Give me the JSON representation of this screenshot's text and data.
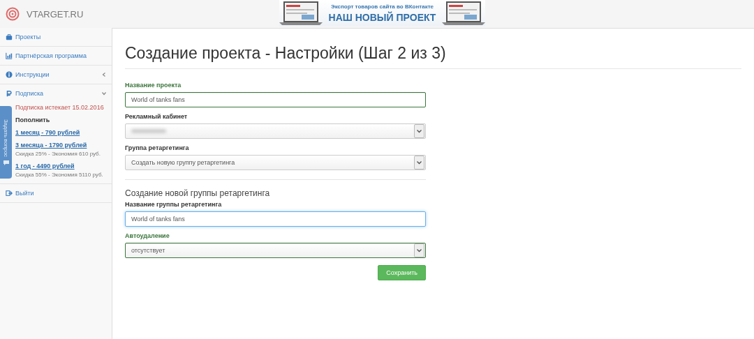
{
  "header": {
    "logo": "VTARGET.RU",
    "banner": {
      "line1": "Экспорт товаров сайта во ВКонтакте",
      "line2": "НАШ НОВЫЙ ПРОЕКТ"
    }
  },
  "sidebar": {
    "items": [
      {
        "label": "Проекты",
        "kind": "briefcase"
      },
      {
        "label": "Партнёрская программа",
        "kind": "chart"
      },
      {
        "label": "Инструкции",
        "kind": "info",
        "expanded": false
      },
      {
        "label": "Подписка",
        "kind": "ruble",
        "expanded": true,
        "expiry": "Подписка истекает 15.02.2016",
        "heading": "Пополнить",
        "plans": [
          {
            "link": "1 месяц - 790 рублей"
          },
          {
            "link": "3 месяца - 1790 рублей",
            "note": "Скидка 25% - Экономия 610 руб."
          },
          {
            "link": "1 год - 4490 рублей",
            "note": "Скидка 55% - Экономия 5110 руб."
          }
        ]
      },
      {
        "label": "Выйти",
        "kind": "exit"
      }
    ],
    "feedback_tab": "Задать вопрос"
  },
  "main": {
    "title": "Создание проекта - Настройки (Шаг 2 из 3)",
    "fields": [
      {
        "kind": "text",
        "label": "Название проекта",
        "value": "World of tanks fans",
        "valid": true,
        "focused": false
      },
      {
        "kind": "select",
        "label": "Рекламный кабинет",
        "valid": false,
        "focused": false
      },
      {
        "kind": "select",
        "label": "Группа ретаргетинга",
        "value": "Создать новую группу ретаргетинга",
        "valid": false,
        "focused": false
      },
      {
        "kind": "section",
        "label": "Создание новой группы ретаргетинга"
      },
      {
        "kind": "text",
        "label": "Название группы ретаргетинга",
        "value": "World of tanks fans",
        "valid": false,
        "focused": true
      },
      {
        "kind": "select",
        "label": "Автоудаление",
        "value": "отсутствует",
        "valid": true,
        "focused": false
      }
    ],
    "save_button": "Сохранить"
  }
}
